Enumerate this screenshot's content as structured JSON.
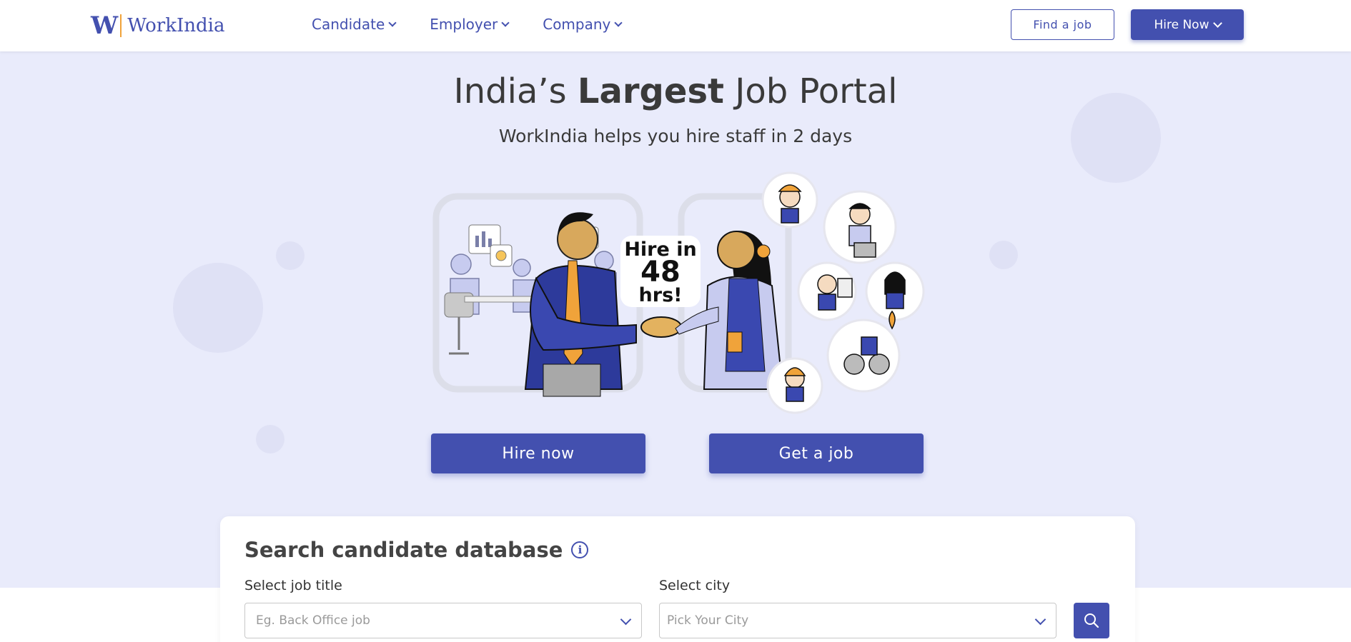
{
  "header": {
    "logo_mark": "W",
    "logo_text": "WorkIndia",
    "nav": [
      {
        "label": "Candidate"
      },
      {
        "label": "Employer"
      },
      {
        "label": "Company"
      }
    ],
    "find_job_label": "Find a job",
    "hire_now_label": "Hire Now"
  },
  "hero": {
    "title_pre": "India’s ",
    "title_bold": "Largest",
    "title_post": " Job Portal",
    "subtitle": "WorkIndia helps you hire staff in 2 days",
    "bubble_line1": "Hire in",
    "bubble_line2": "48",
    "bubble_line3": "hrs!",
    "hire_button": "Hire now",
    "job_button": "Get a job"
  },
  "search": {
    "title": "Search candidate database",
    "info_glyph": "i",
    "job_label": "Select job title",
    "job_placeholder": "Eg. Back Office job",
    "city_label": "Select city",
    "city_placeholder": "Pick Your City"
  },
  "colors": {
    "brand": "#4350af",
    "accent": "#f0a33a",
    "background": "#e9ebfb"
  }
}
